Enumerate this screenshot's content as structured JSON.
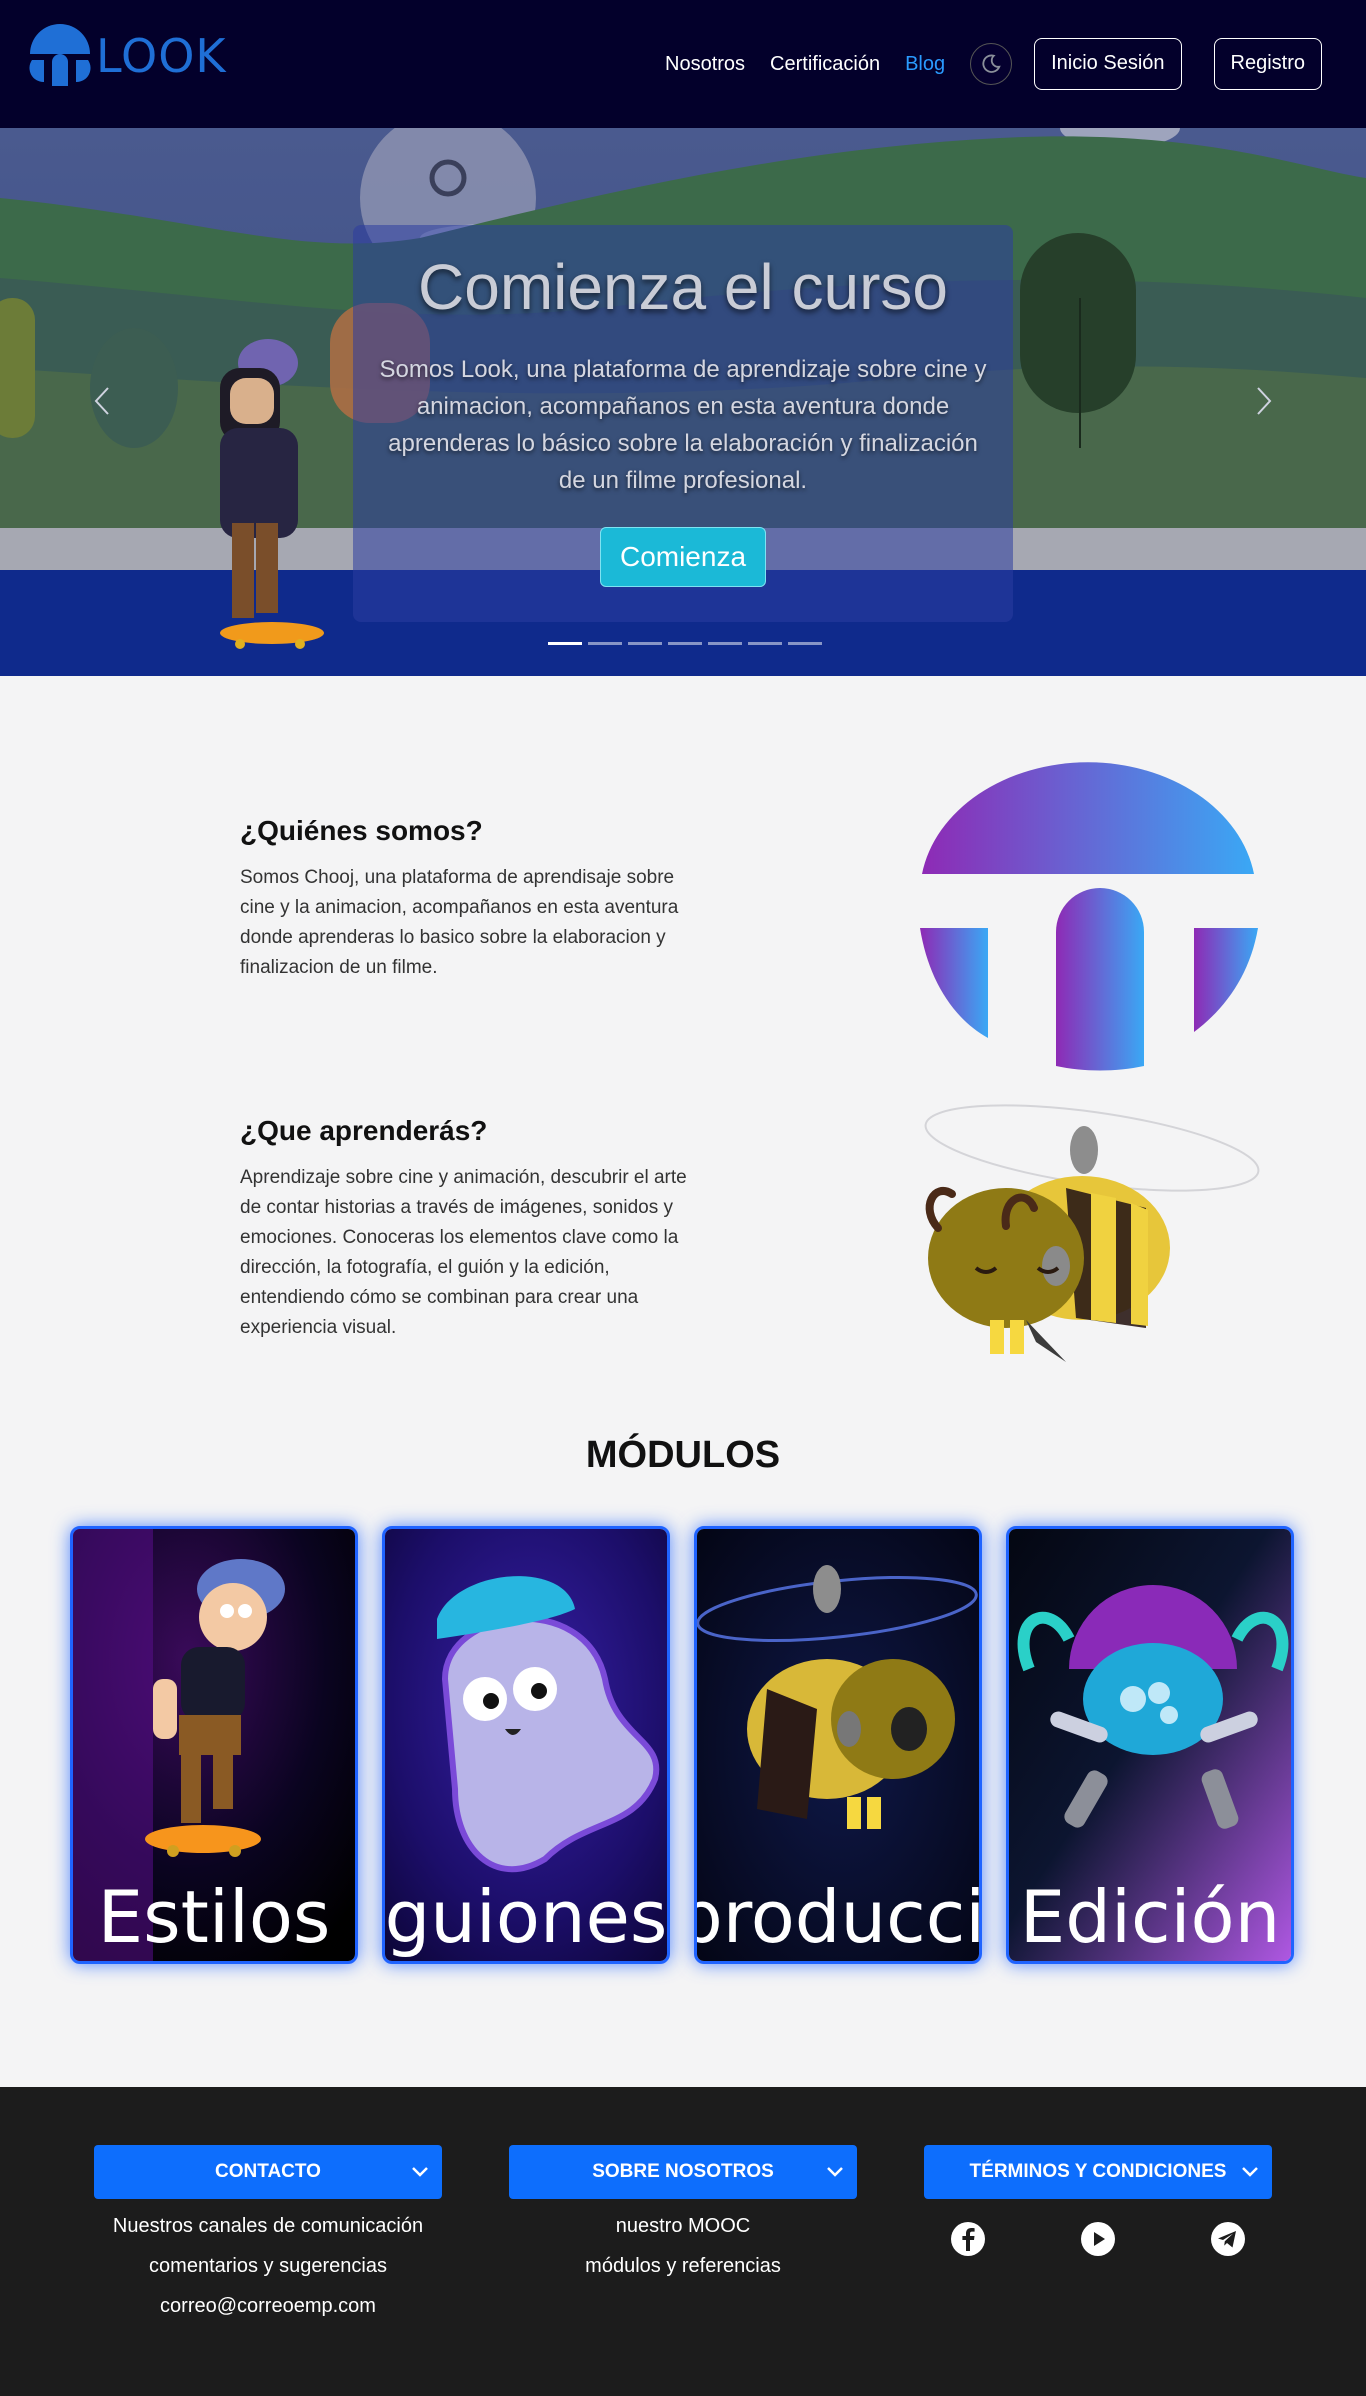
{
  "brand": {
    "name": "LOOK",
    "color": "#1f6fd6"
  },
  "nav": {
    "links": [
      "Nosotros",
      "Certificación",
      "Blog"
    ],
    "active_index": 2,
    "theme_toggle_icon": "moon-icon",
    "login": "Inicio Sesión",
    "register": "Registro"
  },
  "hero": {
    "title": "Comienza el curso",
    "text": "Somos Look, una plataforma de aprendizaje sobre cine y animacion, acompañanos en esta aventura donde aprenderas lo básico sobre la elaboración y finalización de un filme profesional.",
    "button": "Comienza",
    "slides": 7,
    "active_slide": 0,
    "prev_icon": "chevron-left-icon",
    "next_icon": "chevron-right-icon"
  },
  "about": [
    {
      "title": "¿Quiénes somos?",
      "text": "Somos Chooj, una plataforma de aprendisaje sobre cine y la animacion, acompañanos en esta aventura donde aprenderas lo basico sobre la elaboracion y finalizacion de un filme."
    },
    {
      "title": "¿Que aprenderás?",
      "text": "Aprendizaje sobre cine y animación, descubrir el arte de contar historias a través de imágenes, sonidos y emociones. Conoceras los elementos clave como la dirección, la fotografía, el guión y la edición, entendiendo cómo se combinan para crear una experiencia visual."
    }
  ],
  "modules": {
    "title": "MÓDULOS",
    "cards": [
      {
        "label": "Estilos"
      },
      {
        "label": "guiones"
      },
      {
        "label": "producción"
      },
      {
        "label": "Edición"
      }
    ],
    "border_color": "#1f63ff"
  },
  "footer": {
    "columns": [
      {
        "button": "CONTACTO",
        "items": [
          "Nuestros canales de comunicación",
          "comentarios y sugerencias",
          "correo@correoemp.com"
        ]
      },
      {
        "button": "SOBRE NOSOTROS",
        "items": [
          "nuestro MOOC",
          "módulos y referencias"
        ]
      },
      {
        "button": "TÉRMINOS Y CONDICIONES",
        "social": [
          "facebook-icon",
          "youtube-icon",
          "telegram-icon"
        ]
      }
    ],
    "button_color": "#0d6efd"
  }
}
